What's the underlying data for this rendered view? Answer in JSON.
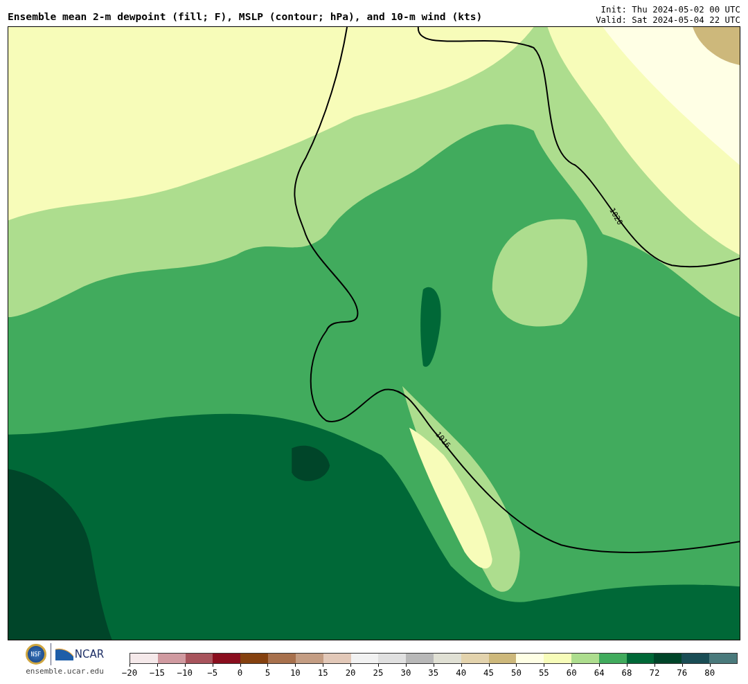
{
  "title": "Ensemble mean 2-m dewpoint (fill; F), MSLP (contour; hPa), and 10-m wind (kts)",
  "init": "Init: Thu 2024-05-02 00 UTC",
  "valid": "Valid: Sat 2024-05-04 22 UTC",
  "map": {
    "contour_labels": [
      "1020",
      "1016"
    ]
  },
  "logos": {
    "nsf": "NSF",
    "ncar": "NCAR",
    "url": "ensemble.ucar.edu"
  },
  "colorbar": {
    "segments": [
      {
        "color": "#f5e9ea"
      },
      {
        "color": "#d09aa0"
      },
      {
        "color": "#a8545c"
      },
      {
        "color": "#8a0e1e"
      },
      {
        "color": "#85410f"
      },
      {
        "color": "#a8714d"
      },
      {
        "color": "#c49d83"
      },
      {
        "color": "#e2c8b8"
      },
      {
        "color": "#f2f2f2"
      },
      {
        "color": "#e0e0e0"
      },
      {
        "color": "#b8b8b8"
      },
      {
        "color": "#e0e0d4"
      },
      {
        "color": "#e3d3ad"
      },
      {
        "color": "#cdb87b"
      },
      {
        "color": "#ffffe5"
      },
      {
        "color": "#f7fcb9"
      },
      {
        "color": "#addd8e"
      },
      {
        "color": "#41ab5d"
      },
      {
        "color": "#006837"
      },
      {
        "color": "#004529"
      },
      {
        "color": "#1a4d55"
      },
      {
        "color": "#4a7a7c"
      }
    ],
    "ticks": [
      "−20",
      "−15",
      "−10",
      "−5",
      "0",
      "5",
      "10",
      "15",
      "20",
      "25",
      "30",
      "35",
      "40",
      "45",
      "50",
      "55",
      "60",
      "64",
      "68",
      "72",
      "76",
      "80"
    ]
  }
}
